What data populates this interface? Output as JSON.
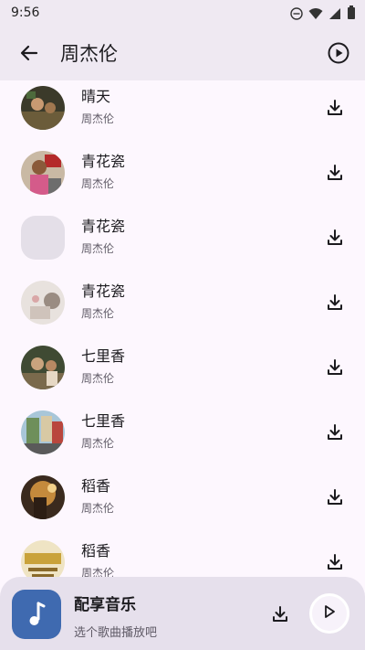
{
  "status_bar": {
    "time": "9:56",
    "icons": [
      "dnd-icon",
      "wifi-icon",
      "signal-icon",
      "battery-icon"
    ]
  },
  "app_bar": {
    "title": "周杰伦",
    "back_icon": "arrow-back-icon",
    "play_all_icon": "play-circle-icon"
  },
  "songs": [
    {
      "title": "晴天",
      "artist": "周杰伦",
      "cover": "photo"
    },
    {
      "title": "青花瓷",
      "artist": "周杰伦",
      "cover": "photo"
    },
    {
      "title": "青花瓷",
      "artist": "周杰伦",
      "cover": "placeholder"
    },
    {
      "title": "青花瓷",
      "artist": "周杰伦",
      "cover": "photo"
    },
    {
      "title": "七里香",
      "artist": "周杰伦",
      "cover": "photo"
    },
    {
      "title": "七里香",
      "artist": "周杰伦",
      "cover": "photo"
    },
    {
      "title": "稻香",
      "artist": "周杰伦",
      "cover": "photo"
    },
    {
      "title": "稻香",
      "artist": "周杰伦",
      "cover": "photo"
    }
  ],
  "player": {
    "title": "配享音乐",
    "subtitle": "选个歌曲播放吧",
    "art_icon": "music-note-icon",
    "download_icon": "download-icon",
    "play_icon": "play-icon"
  },
  "colors": {
    "background": "#fdf7fe",
    "app_bar": "#efe9f2",
    "player_bar": "#e6e0ec",
    "player_art": "#3f6ab0"
  }
}
